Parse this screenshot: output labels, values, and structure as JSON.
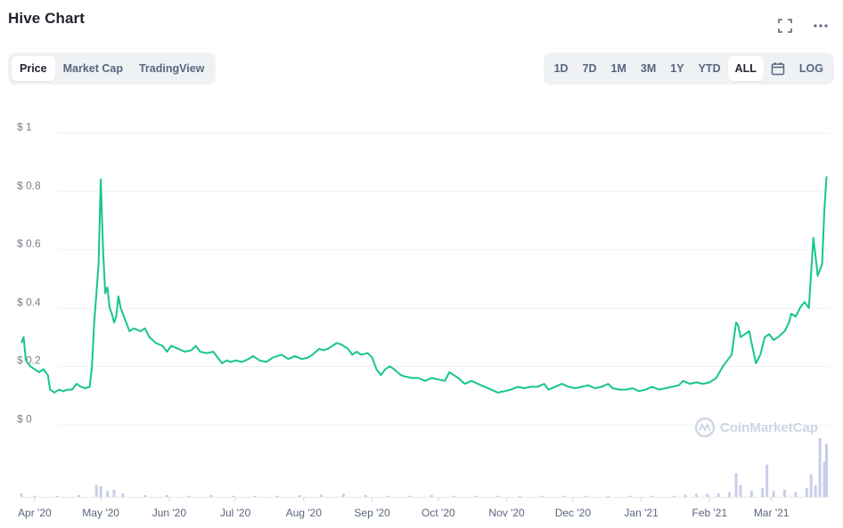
{
  "header": {
    "title": "Hive Chart"
  },
  "top_icons": [
    "fullscreen-icon",
    "more-icon"
  ],
  "view_tabs": [
    {
      "label": "Price",
      "active": true
    },
    {
      "label": "Market Cap",
      "active": false
    },
    {
      "label": "TradingView",
      "active": false
    }
  ],
  "range_tabs": [
    {
      "label": "1D",
      "active": false
    },
    {
      "label": "7D",
      "active": false
    },
    {
      "label": "1M",
      "active": false
    },
    {
      "label": "3M",
      "active": false
    },
    {
      "label": "1Y",
      "active": false
    },
    {
      "label": "YTD",
      "active": false
    },
    {
      "label": "ALL",
      "active": true
    }
  ],
  "calendar_icon": "calendar-icon",
  "log_label": "LOG",
  "watermark": "CoinMarketCap",
  "colors": {
    "line": "#16c784",
    "volume": "#c9cdea",
    "grid": "#eff2f5",
    "tab_bg": "#eff2f5"
  },
  "chart_data": {
    "type": "line",
    "title": "Hive Chart",
    "xlabel": "",
    "ylabel": "",
    "ylim": [
      0,
      1
    ],
    "yticks": [
      0,
      0.2,
      0.4,
      0.6,
      0.8,
      1
    ],
    "ytick_labels": [
      "$ 0",
      "$ 0.2",
      "$ 0.4",
      "$ 0.6",
      "$ 0.8",
      "$ 1"
    ],
    "xticks": [
      {
        "label": "Apr '20",
        "day": 0
      },
      {
        "label": "May '20",
        "day": 30
      },
      {
        "label": "Jun '20",
        "day": 61
      },
      {
        "label": "Jul '20",
        "day": 91
      },
      {
        "label": "Aug '20",
        "day": 122
      },
      {
        "label": "Sep '20",
        "day": 153
      },
      {
        "label": "Oct '20",
        "day": 183
      },
      {
        "label": "Nov '20",
        "day": 214
      },
      {
        "label": "Dec '20",
        "day": 244
      },
      {
        "label": "Jan '21",
        "day": 275
      },
      {
        "label": "Feb '21",
        "day": 306
      },
      {
        "label": "Mar '21",
        "day": 334
      }
    ],
    "xlim_days": [
      -6,
      360
    ],
    "grid": true,
    "series": [
      {
        "points": [
          [
            -6,
            0.28
          ],
          [
            -5,
            0.3
          ],
          [
            -4,
            0.22
          ],
          [
            -2,
            0.2
          ],
          [
            0,
            0.19
          ],
          [
            2,
            0.18
          ],
          [
            4,
            0.19
          ],
          [
            6,
            0.17
          ],
          [
            7,
            0.12
          ],
          [
            9,
            0.11
          ],
          [
            11,
            0.12
          ],
          [
            13,
            0.115
          ],
          [
            15,
            0.12
          ],
          [
            17,
            0.12
          ],
          [
            19,
            0.14
          ],
          [
            21,
            0.13
          ],
          [
            23,
            0.125
          ],
          [
            25,
            0.13
          ],
          [
            26,
            0.2
          ],
          [
            27,
            0.35
          ],
          [
            28,
            0.45
          ],
          [
            29,
            0.55
          ],
          [
            30,
            0.84
          ],
          [
            31,
            0.6
          ],
          [
            32,
            0.45
          ],
          [
            33,
            0.47
          ],
          [
            34,
            0.4
          ],
          [
            35,
            0.38
          ],
          [
            36,
            0.35
          ],
          [
            37,
            0.37
          ],
          [
            38,
            0.44
          ],
          [
            39,
            0.4
          ],
          [
            41,
            0.36
          ],
          [
            43,
            0.32
          ],
          [
            45,
            0.33
          ],
          [
            48,
            0.32
          ],
          [
            50,
            0.33
          ],
          [
            52,
            0.3
          ],
          [
            55,
            0.28
          ],
          [
            58,
            0.27
          ],
          [
            60,
            0.25
          ],
          [
            62,
            0.27
          ],
          [
            65,
            0.26
          ],
          [
            68,
            0.25
          ],
          [
            71,
            0.255
          ],
          [
            73,
            0.27
          ],
          [
            75,
            0.25
          ],
          [
            78,
            0.245
          ],
          [
            81,
            0.25
          ],
          [
            83,
            0.23
          ],
          [
            85,
            0.21
          ],
          [
            87,
            0.22
          ],
          [
            89,
            0.215
          ],
          [
            91,
            0.22
          ],
          [
            94,
            0.215
          ],
          [
            97,
            0.225
          ],
          [
            99,
            0.235
          ],
          [
            102,
            0.22
          ],
          [
            105,
            0.215
          ],
          [
            108,
            0.23
          ],
          [
            110,
            0.235
          ],
          [
            112,
            0.24
          ],
          [
            115,
            0.225
          ],
          [
            118,
            0.235
          ],
          [
            121,
            0.225
          ],
          [
            124,
            0.23
          ],
          [
            126,
            0.24
          ],
          [
            129,
            0.26
          ],
          [
            131,
            0.255
          ],
          [
            133,
            0.26
          ],
          [
            135,
            0.27
          ],
          [
            137,
            0.28
          ],
          [
            139,
            0.275
          ],
          [
            142,
            0.26
          ],
          [
            144,
            0.24
          ],
          [
            146,
            0.25
          ],
          [
            148,
            0.24
          ],
          [
            151,
            0.245
          ],
          [
            153,
            0.23
          ],
          [
            155,
            0.19
          ],
          [
            157,
            0.17
          ],
          [
            159,
            0.19
          ],
          [
            161,
            0.2
          ],
          [
            163,
            0.19
          ],
          [
            166,
            0.17
          ],
          [
            168,
            0.165
          ],
          [
            171,
            0.16
          ],
          [
            174,
            0.16
          ],
          [
            177,
            0.15
          ],
          [
            180,
            0.16
          ],
          [
            183,
            0.155
          ],
          [
            186,
            0.15
          ],
          [
            188,
            0.18
          ],
          [
            190,
            0.17
          ],
          [
            192,
            0.16
          ],
          [
            195,
            0.14
          ],
          [
            198,
            0.15
          ],
          [
            201,
            0.14
          ],
          [
            204,
            0.13
          ],
          [
            207,
            0.12
          ],
          [
            210,
            0.11
          ],
          [
            213,
            0.115
          ],
          [
            216,
            0.12
          ],
          [
            219,
            0.13
          ],
          [
            222,
            0.125
          ],
          [
            225,
            0.13
          ],
          [
            228,
            0.13
          ],
          [
            231,
            0.14
          ],
          [
            233,
            0.12
          ],
          [
            236,
            0.13
          ],
          [
            239,
            0.14
          ],
          [
            242,
            0.13
          ],
          [
            245,
            0.125
          ],
          [
            248,
            0.13
          ],
          [
            251,
            0.135
          ],
          [
            254,
            0.125
          ],
          [
            257,
            0.13
          ],
          [
            260,
            0.14
          ],
          [
            262,
            0.125
          ],
          [
            265,
            0.12
          ],
          [
            268,
            0.12
          ],
          [
            271,
            0.125
          ],
          [
            274,
            0.115
          ],
          [
            277,
            0.12
          ],
          [
            280,
            0.13
          ],
          [
            283,
            0.12
          ],
          [
            286,
            0.125
          ],
          [
            289,
            0.13
          ],
          [
            292,
            0.135
          ],
          [
            294,
            0.15
          ],
          [
            297,
            0.14
          ],
          [
            300,
            0.145
          ],
          [
            303,
            0.14
          ],
          [
            306,
            0.145
          ],
          [
            309,
            0.16
          ],
          [
            312,
            0.2
          ],
          [
            314,
            0.22
          ],
          [
            316,
            0.24
          ],
          [
            318,
            0.35
          ],
          [
            319,
            0.34
          ],
          [
            320,
            0.3
          ],
          [
            322,
            0.31
          ],
          [
            324,
            0.32
          ],
          [
            325,
            0.28
          ],
          [
            327,
            0.21
          ],
          [
            329,
            0.24
          ],
          [
            331,
            0.3
          ],
          [
            333,
            0.31
          ],
          [
            335,
            0.29
          ],
          [
            337,
            0.3
          ],
          [
            340,
            0.32
          ],
          [
            342,
            0.35
          ],
          [
            343,
            0.38
          ],
          [
            345,
            0.37
          ],
          [
            347,
            0.4
          ],
          [
            349,
            0.42
          ],
          [
            351,
            0.4
          ],
          [
            353,
            0.64
          ],
          [
            354,
            0.58
          ],
          [
            355,
            0.51
          ],
          [
            356,
            0.53
          ],
          [
            357,
            0.55
          ],
          [
            358,
            0.73
          ],
          [
            359,
            0.85
          ]
        ]
      }
    ],
    "volume": [
      [
        -6,
        0.06
      ],
      [
        0,
        0.02
      ],
      [
        10,
        0.02
      ],
      [
        20,
        0.03
      ],
      [
        28,
        0.2
      ],
      [
        30,
        0.18
      ],
      [
        33,
        0.1
      ],
      [
        36,
        0.12
      ],
      [
        40,
        0.06
      ],
      [
        50,
        0.03
      ],
      [
        60,
        0.03
      ],
      [
        70,
        0.02
      ],
      [
        80,
        0.03
      ],
      [
        90,
        0.02
      ],
      [
        100,
        0.02
      ],
      [
        110,
        0.02
      ],
      [
        120,
        0.03
      ],
      [
        130,
        0.04
      ],
      [
        140,
        0.05
      ],
      [
        150,
        0.03
      ],
      [
        160,
        0.02
      ],
      [
        170,
        0.02
      ],
      [
        180,
        0.03
      ],
      [
        190,
        0.02
      ],
      [
        200,
        0.02
      ],
      [
        210,
        0.02
      ],
      [
        220,
        0.02
      ],
      [
        230,
        0.02
      ],
      [
        240,
        0.02
      ],
      [
        250,
        0.02
      ],
      [
        260,
        0.02
      ],
      [
        270,
        0.02
      ],
      [
        280,
        0.02
      ],
      [
        290,
        0.02
      ],
      [
        295,
        0.04
      ],
      [
        300,
        0.05
      ],
      [
        305,
        0.05
      ],
      [
        310,
        0.06
      ],
      [
        315,
        0.08
      ],
      [
        318,
        0.4
      ],
      [
        320,
        0.2
      ],
      [
        325,
        0.1
      ],
      [
        330,
        0.15
      ],
      [
        332,
        0.55
      ],
      [
        335,
        0.1
      ],
      [
        340,
        0.12
      ],
      [
        345,
        0.08
      ],
      [
        350,
        0.15
      ],
      [
        352,
        0.38
      ],
      [
        354,
        0.2
      ],
      [
        356,
        1.0
      ],
      [
        358,
        0.6
      ],
      [
        359,
        0.9
      ]
    ]
  }
}
